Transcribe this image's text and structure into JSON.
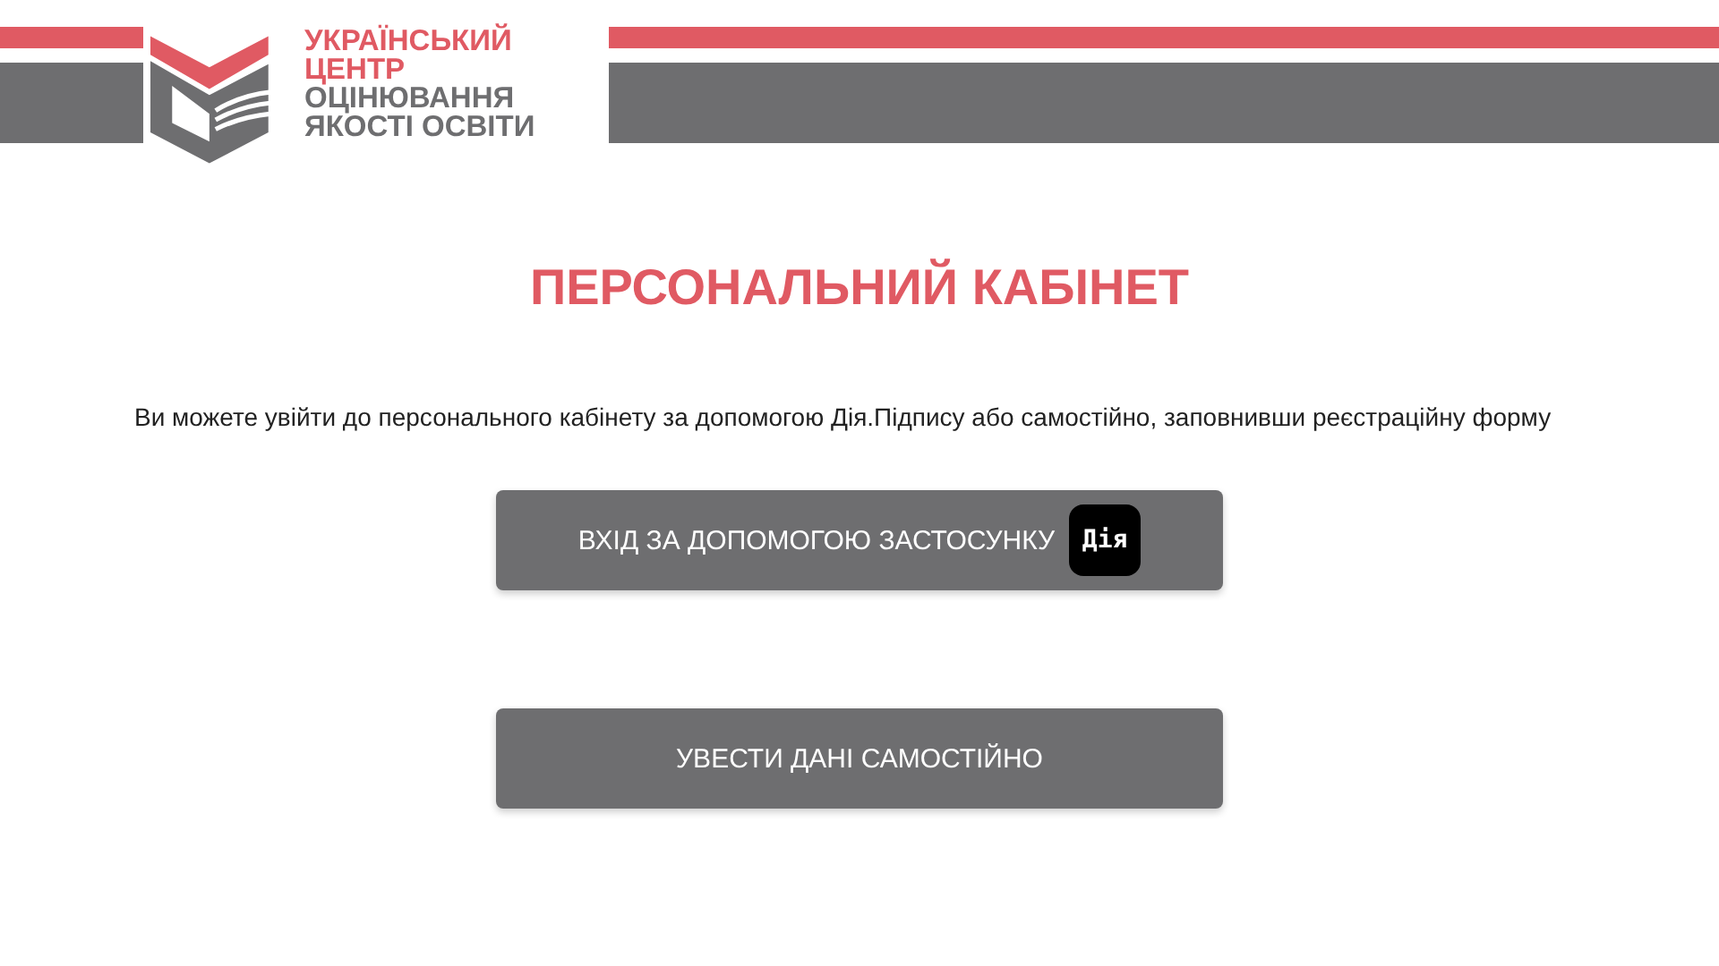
{
  "logo": {
    "lines": [
      {
        "text": "УКРАЇНСЬКИЙ",
        "kind": "accent"
      },
      {
        "text": "ЦЕНТР",
        "kind": "accent"
      },
      {
        "text": "ОЦІНЮВАННЯ",
        "kind": "plain"
      },
      {
        "text": "ЯКОСТІ ОСВІТИ",
        "kind": "plain"
      }
    ]
  },
  "title": "ПЕРСОНАЛЬНИЙ КАБІНЕТ",
  "intro": "Ви можете увійти до персонального кабінету за допомогою Дія.Підпису або самостійно, заповнивши реєстраційну форму",
  "buttons": [
    {
      "label": "ВХІД ЗА ДОПОМОГОЮ ЗАСТОСУНКУ",
      "badge": "Дія"
    },
    {
      "label": "УВЕСТИ ДАНІ САМОСТІЙНО"
    }
  ]
}
